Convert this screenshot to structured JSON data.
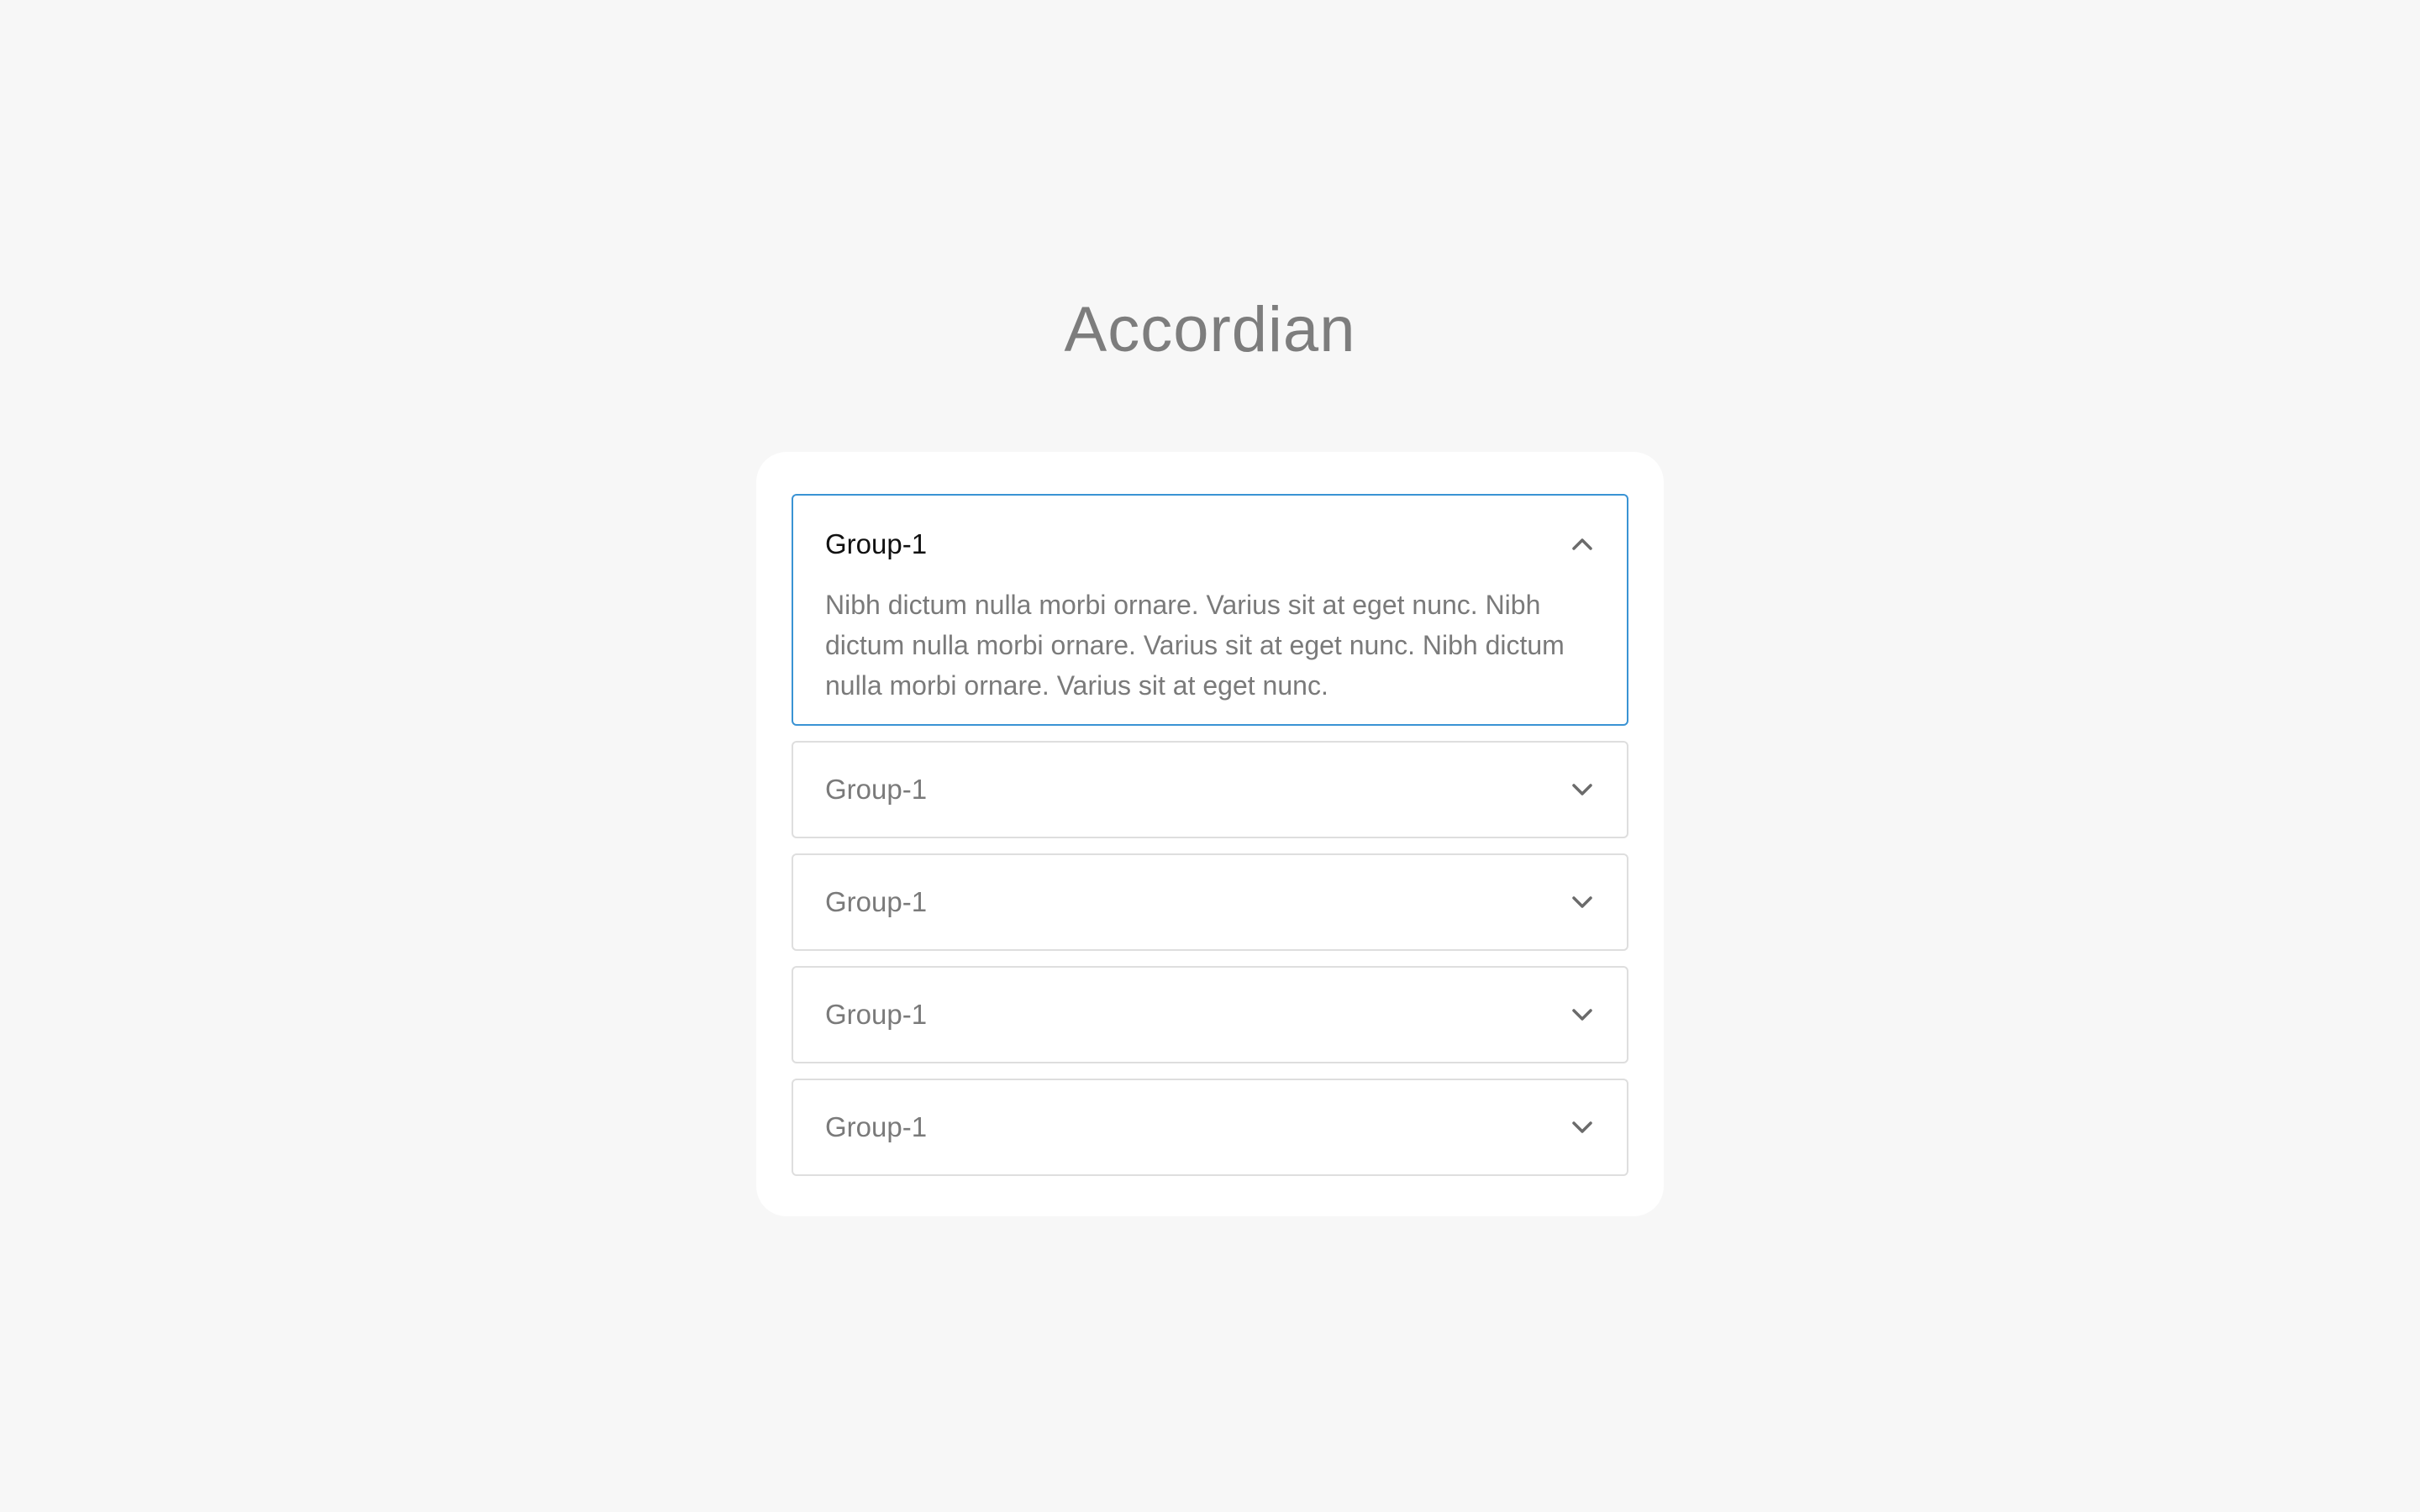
{
  "page": {
    "title": "Accordian"
  },
  "accordion": {
    "items": [
      {
        "title": "Group-1",
        "expanded": true,
        "content": "Nibh dictum nulla morbi ornare. Varius sit at eget nunc. Nibh dictum nulla morbi ornare. Varius sit at eget nunc. Nibh dictum nulla morbi ornare. Varius sit at eget nunc.",
        "icon": "chevron-up-icon"
      },
      {
        "title": "Group-1",
        "expanded": false,
        "icon": "chevron-down-icon"
      },
      {
        "title": "Group-1",
        "expanded": false,
        "icon": "chevron-down-icon"
      },
      {
        "title": "Group-1",
        "expanded": false,
        "icon": "chevron-down-icon"
      },
      {
        "title": "Group-1",
        "expanded": false,
        "icon": "chevron-down-icon"
      }
    ]
  },
  "colors": {
    "background": "#f7f7f7",
    "card": "#ffffff",
    "active_border": "#3a93d4",
    "border": "#dedede",
    "muted_text": "#7a7a7a",
    "active_text": "#111111"
  }
}
